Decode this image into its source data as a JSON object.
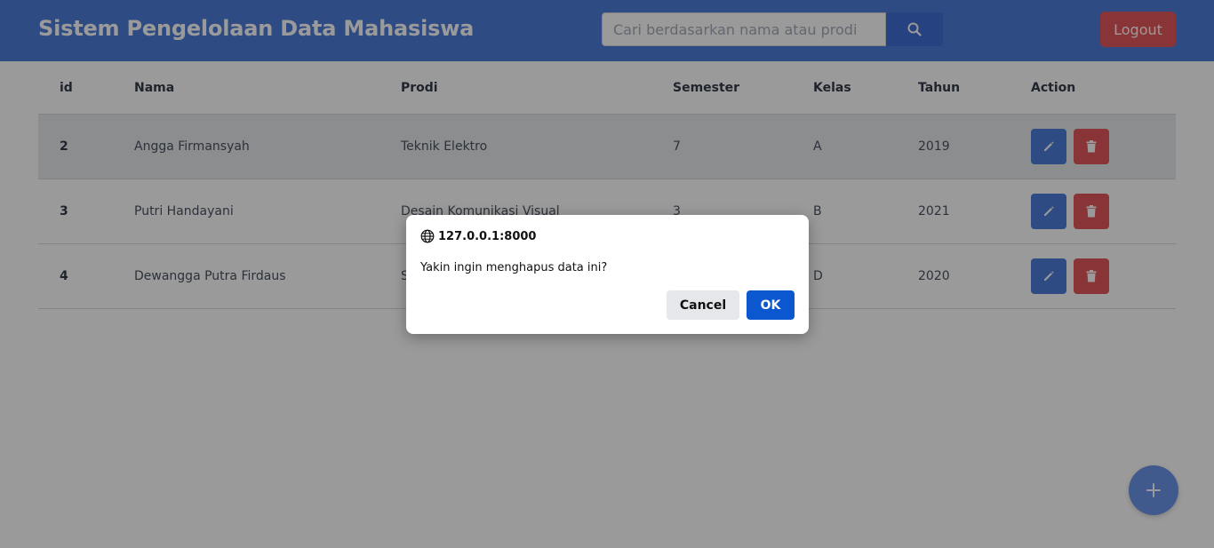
{
  "header": {
    "title": "Sistem Pengelolaan Data Mahasiswa",
    "search_placeholder": "Cari berdasarkan nama atau prodi",
    "search_icon": "search-icon",
    "logout_label": "Logout"
  },
  "table": {
    "headers": [
      "id",
      "Nama",
      "Prodi",
      "Semester",
      "Kelas",
      "Tahun",
      "Action"
    ],
    "rows": [
      {
        "id": "2",
        "nama": "Angga Firmansyah",
        "prodi": "Teknik Elektro",
        "semester": "7",
        "kelas": "A",
        "tahun": "2019"
      },
      {
        "id": "3",
        "nama": "Putri Handayani",
        "prodi": "Desain Komunikasi Visual",
        "semester": "3",
        "kelas": "B",
        "tahun": "2021"
      },
      {
        "id": "4",
        "nama": "Dewangga Putra Firdaus",
        "prodi": "S",
        "semester": "",
        "kelas": "D",
        "tahun": "2020"
      }
    ],
    "action_icons": [
      "pencil-icon",
      "trash-icon"
    ]
  },
  "fab": {
    "icon": "plus-icon"
  },
  "dialog": {
    "origin": "127.0.0.1:8000",
    "message": "Yakin ingin menghapus data ini?",
    "cancel_label": "Cancel",
    "ok_label": "OK"
  },
  "colors": {
    "primary": "#3B6FD6",
    "danger": "#E1474C",
    "dialog_ok": "#0B57D0"
  }
}
